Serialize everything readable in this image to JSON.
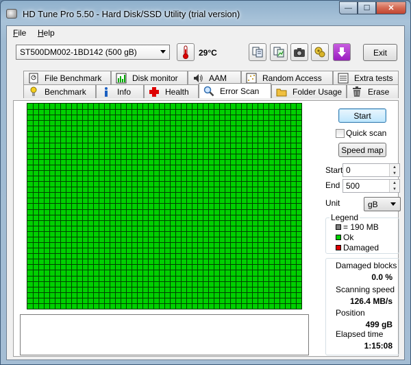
{
  "window": {
    "title": "HD Tune Pro 5.50 - Hard Disk/SSD Utility (trial version)",
    "controls": {
      "minimize": "—",
      "maximize": "☐",
      "close": "✕"
    }
  },
  "menu": {
    "file": {
      "accel": "F",
      "rest": "ile"
    },
    "help": {
      "accel": "H",
      "rest": "elp"
    }
  },
  "toolbar": {
    "drive": "ST500DM002-1BD142 (500 gB)",
    "temperature": "29°C",
    "exit_label": "Exit"
  },
  "tabs": {
    "top": [
      {
        "label": "File Benchmark",
        "icon": "file-benchmark-icon"
      },
      {
        "label": "Disk monitor",
        "icon": "disk-monitor-icon"
      },
      {
        "label": "AAM",
        "icon": "speaker-icon"
      },
      {
        "label": "Random Access",
        "icon": "random-access-icon"
      },
      {
        "label": "Extra tests",
        "icon": "extra-tests-icon"
      }
    ],
    "bottom": [
      {
        "label": "Benchmark",
        "icon": "benchmark-icon"
      },
      {
        "label": "Info",
        "icon": "info-icon"
      },
      {
        "label": "Health",
        "icon": "health-cross-icon"
      },
      {
        "label": "Error Scan",
        "icon": "magnifier-icon",
        "active": true
      },
      {
        "label": "Folder Usage",
        "icon": "folder-icon"
      },
      {
        "label": "Erase",
        "icon": "trash-icon"
      }
    ]
  },
  "scan": {
    "grid": {
      "cols": 50,
      "rows": 37,
      "block_color": "#00d000",
      "line_color": "#004000"
    },
    "start_button": "Start",
    "quick_scan_label": "Quick scan",
    "quick_scan_checked": false,
    "speed_map_button": "Speed map",
    "start_label": "Start",
    "start_value": "0",
    "end_label": "End",
    "end_value": "500",
    "unit_label": "Unit",
    "unit_value": "gB"
  },
  "legend": {
    "title": "Legend",
    "items": [
      {
        "label": "= 190 MB",
        "color": "#808080"
      },
      {
        "label": "Ok",
        "color": "#00d000"
      },
      {
        "label": "Damaged",
        "color": "#e00000"
      }
    ]
  },
  "stats": {
    "damaged_blocks_label": "Damaged blocks",
    "damaged_blocks_value": "0.0 %",
    "scanning_speed_label": "Scanning speed",
    "scanning_speed_value": "126.4 MB/s",
    "position_label": "Position",
    "position_value": "499 gB",
    "elapsed_label": "Elapsed time",
    "elapsed_value": "1:15:08"
  }
}
